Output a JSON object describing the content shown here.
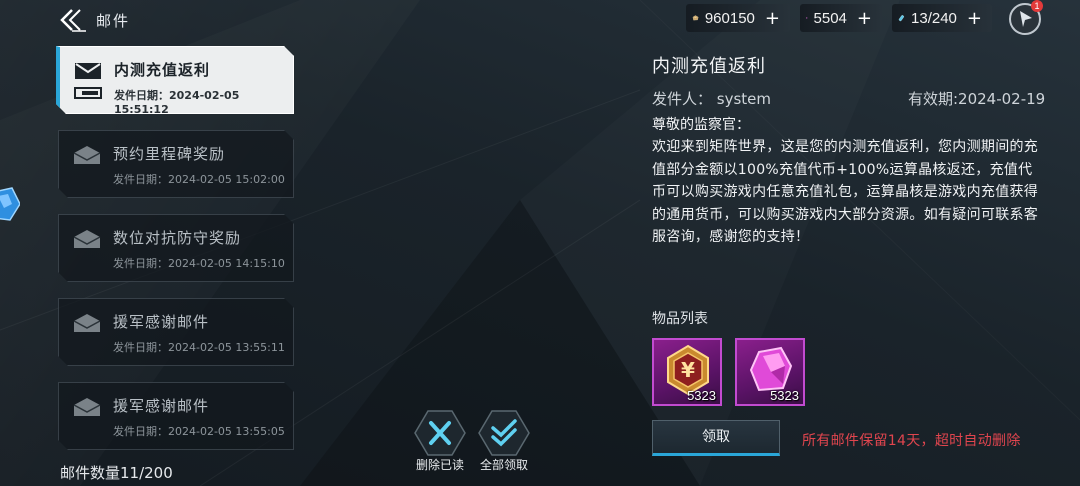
{
  "header": {
    "title": "邮件",
    "back_icon": "back-arrow-icon"
  },
  "resources": {
    "gold": {
      "value": "960150",
      "plus": "+",
      "icon": "gold-ingot-icon",
      "color": "#c9a56a"
    },
    "gem": {
      "value": "5504",
      "plus": "+",
      "icon": "pink-crystal-icon",
      "color": "#e04ad8"
    },
    "stamina": {
      "value": "13/240",
      "plus": "+",
      "icon": "stamina-vial-icon",
      "color": "#5fc8e6"
    },
    "compass_badge": "1"
  },
  "mail_list": {
    "items": [
      {
        "title": "内测充值返利",
        "date": "发件日期：2024-02-05 15:51:12",
        "selected": true
      },
      {
        "title": "预约里程碑奖励",
        "date": "发件日期：2024-02-05 15:02:00",
        "selected": false
      },
      {
        "title": "数位对抗防守奖励",
        "date": "发件日期：2024-02-05 14:15:10",
        "selected": false
      },
      {
        "title": "援军感谢邮件",
        "date": "发件日期：2024-02-05 13:55:11",
        "selected": false
      },
      {
        "title": "援军感谢邮件",
        "date": "发件日期：2024-02-05 13:55:05",
        "selected": false
      }
    ],
    "count": "邮件数量11/200"
  },
  "actions": {
    "delete_read": "删除已读",
    "claim_all": "全部领取"
  },
  "detail": {
    "title": "内测充值返利",
    "sender": "发件人： system",
    "expiry": "有效期:2024-02-19",
    "greeting": "尊敬的监察官：",
    "body": "欢迎来到矩阵世界，这是您的内测充值返利，您内测期间的充值部分金额以100%充值代币+100%运算晶核返还，充值代币可以购买游戏内任意充值礼包，运算晶核是游戏内充值获得的通用货币，可以购买游戏内大部分资源。如有疑问可联系客服咨询，感谢您的支持！",
    "items_label": "物品列表",
    "items": [
      {
        "icon": "yen-token-icon",
        "qty": "5323"
      },
      {
        "icon": "pink-crystal-icon",
        "qty": "5323"
      }
    ],
    "claim_label": "领取",
    "notice": "所有邮件保留14天，超时自动删除",
    "accent": "#2aa6d8",
    "notice_color": "#e0454e"
  }
}
